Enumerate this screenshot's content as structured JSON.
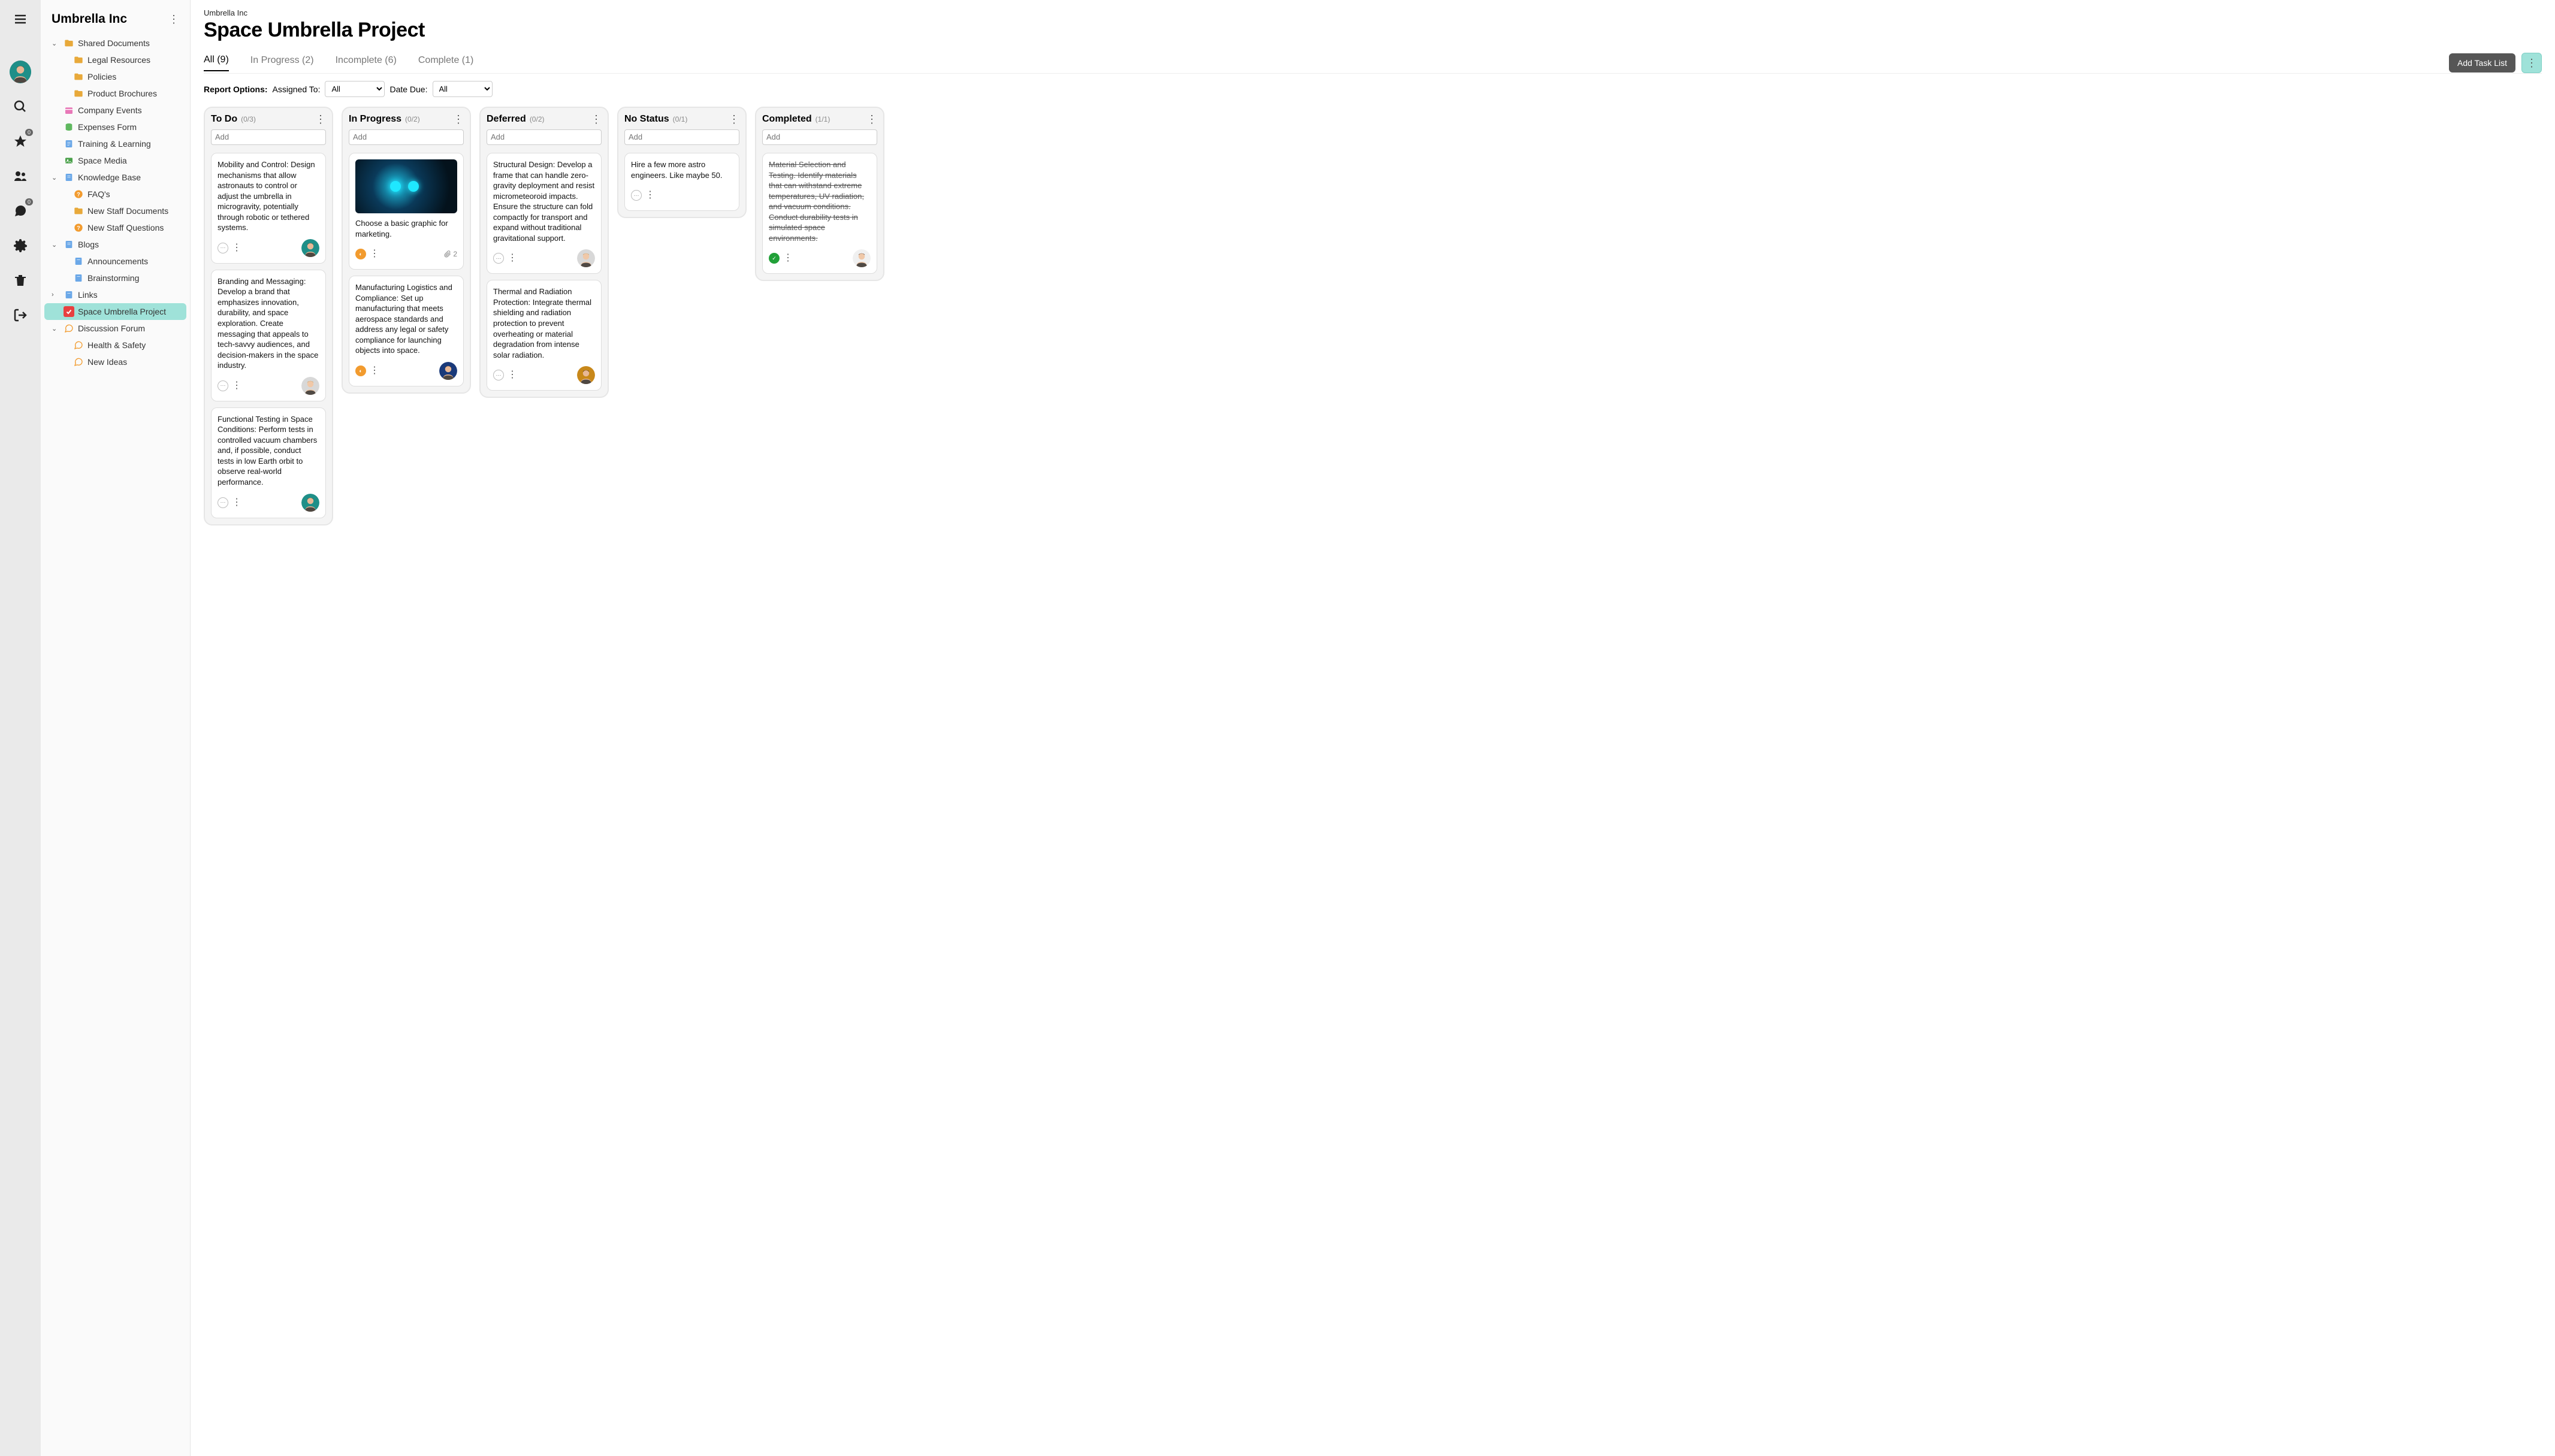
{
  "rail": {
    "star_badge": "0",
    "chat_badge": "0"
  },
  "workspace": {
    "name": "Umbrella Inc"
  },
  "tree": {
    "shared_docs": "Shared Documents",
    "legal": "Legal Resources",
    "policies": "Policies",
    "brochures": "Product Brochures",
    "events": "Company Events",
    "expenses": "Expenses Form",
    "training": "Training & Learning",
    "media": "Space Media",
    "kb": "Knowledge Base",
    "faqs": "FAQ's",
    "newstaff_docs": "New Staff Documents",
    "newstaff_q": "New Staff Questions",
    "blogs": "Blogs",
    "announcements": "Announcements",
    "brainstorming": "Brainstorming",
    "links": "Links",
    "space_project": "Space Umbrella Project",
    "forum": "Discussion Forum",
    "health": "Health & Safety",
    "ideas": "New Ideas"
  },
  "page": {
    "crumb": "Umbrella Inc",
    "title": "Space Umbrella Project",
    "tabs": {
      "all": "All (9)",
      "inprog": "In Progress (2)",
      "incomplete": "Incomplete (6)",
      "complete": "Complete (1)"
    },
    "add_task_list": "Add Task List",
    "filters": {
      "label": "Report Options:",
      "assigned_label": "Assigned To:",
      "assigned_val": "All",
      "due_label": "Date Due:",
      "due_val": "All"
    },
    "add_placeholder": "Add"
  },
  "columns": {
    "todo": {
      "title": "To Do",
      "count": "(0/3)"
    },
    "inprog": {
      "title": "In Progress",
      "count": "(0/2)"
    },
    "deferred": {
      "title": "Deferred",
      "count": "(0/2)"
    },
    "nostatus": {
      "title": "No Status",
      "count": "(0/1)"
    },
    "completed": {
      "title": "Completed",
      "count": "(1/1)"
    }
  },
  "cards": {
    "todo1": "Mobility and Control: Design mechanisms that allow astronauts to control or adjust the umbrella in microgravity, potentially through robotic or tethered systems.",
    "todo2": "Branding and Messaging: Develop a brand that emphasizes innovation, durability, and space exploration. Create messaging that appeals to tech-savvy audiences, and decision-makers in the space industry.",
    "todo3": "Functional Testing in Space Conditions: Perform tests in controlled vacuum chambers and, if possible, conduct tests in low Earth orbit to observe real-world performance.",
    "inprog1": "Choose a basic graphic for marketing.",
    "inprog1_attach": "2",
    "inprog2": "Manufacturing Logistics and Compliance: Set up manufacturing that meets aerospace standards and address any legal or safety compliance for launching objects into space.",
    "def1": "Structural Design: Develop a frame that can handle zero-gravity deployment and resist micrometeoroid impacts. Ensure the structure can fold compactly for transport and expand without traditional gravitational support.",
    "def2": "Thermal and Radiation Protection: Integrate thermal shielding and radiation protection to prevent overheating or material degradation from intense solar radiation.",
    "nostatus1": "Hire a few more astro engineers. Like maybe 50.",
    "comp1": "Material Selection and Testing. Identify materials that can withstand extreme temperatures, UV radiation, and vacuum conditions. Conduct durability tests in simulated space environments."
  },
  "avatars": {
    "teal": {
      "bg": "#1f8f88",
      "skin": "#e8b896",
      "hair": "#6b4a2a"
    },
    "blue": {
      "bg": "#1a3a7a",
      "skin": "#e8b896",
      "hair": "#3a2a1a"
    },
    "grey": {
      "bg": "#d8d8d8",
      "skin": "#f0c8a8",
      "hair": "#c89858"
    },
    "amber": {
      "bg": "#c8881a",
      "skin": "#e8b896",
      "hair": "#2a1a0a"
    },
    "white": {
      "bg": "#f0f0f0",
      "skin": "#f0c8a8",
      "hair": "#4a2a1a"
    }
  }
}
